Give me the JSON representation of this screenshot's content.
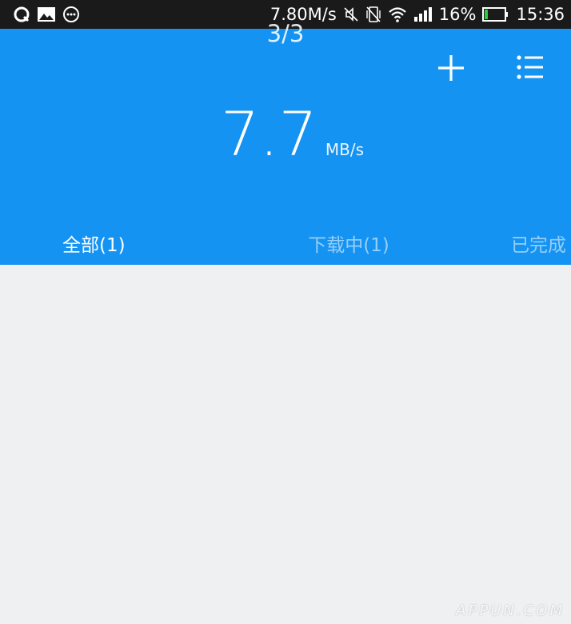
{
  "status_bar": {
    "net_speed": "7.80M/s",
    "battery": "16%",
    "time": "15:36",
    "left_icons": [
      "qq-icon",
      "image-icon",
      "chat-icon"
    ],
    "right_icons": [
      "mute-icon",
      "vibrate-off-icon",
      "wifi-icon",
      "signal-icon",
      "battery-icon"
    ],
    "battery_level": 0.16,
    "battery_color": "#2ECC40"
  },
  "header": {
    "page_counter": "3/3",
    "speed_value": "7.7",
    "speed_unit": "MB/s",
    "bg_color": "#1493F2",
    "actions": [
      "add-icon",
      "list-icon"
    ]
  },
  "tabs": [
    {
      "label": "全部(1)",
      "active": true
    },
    {
      "label": "下载中(1)",
      "active": false
    },
    {
      "label": "已完成",
      "active": false
    }
  ],
  "watermark": "APPUN.COM"
}
